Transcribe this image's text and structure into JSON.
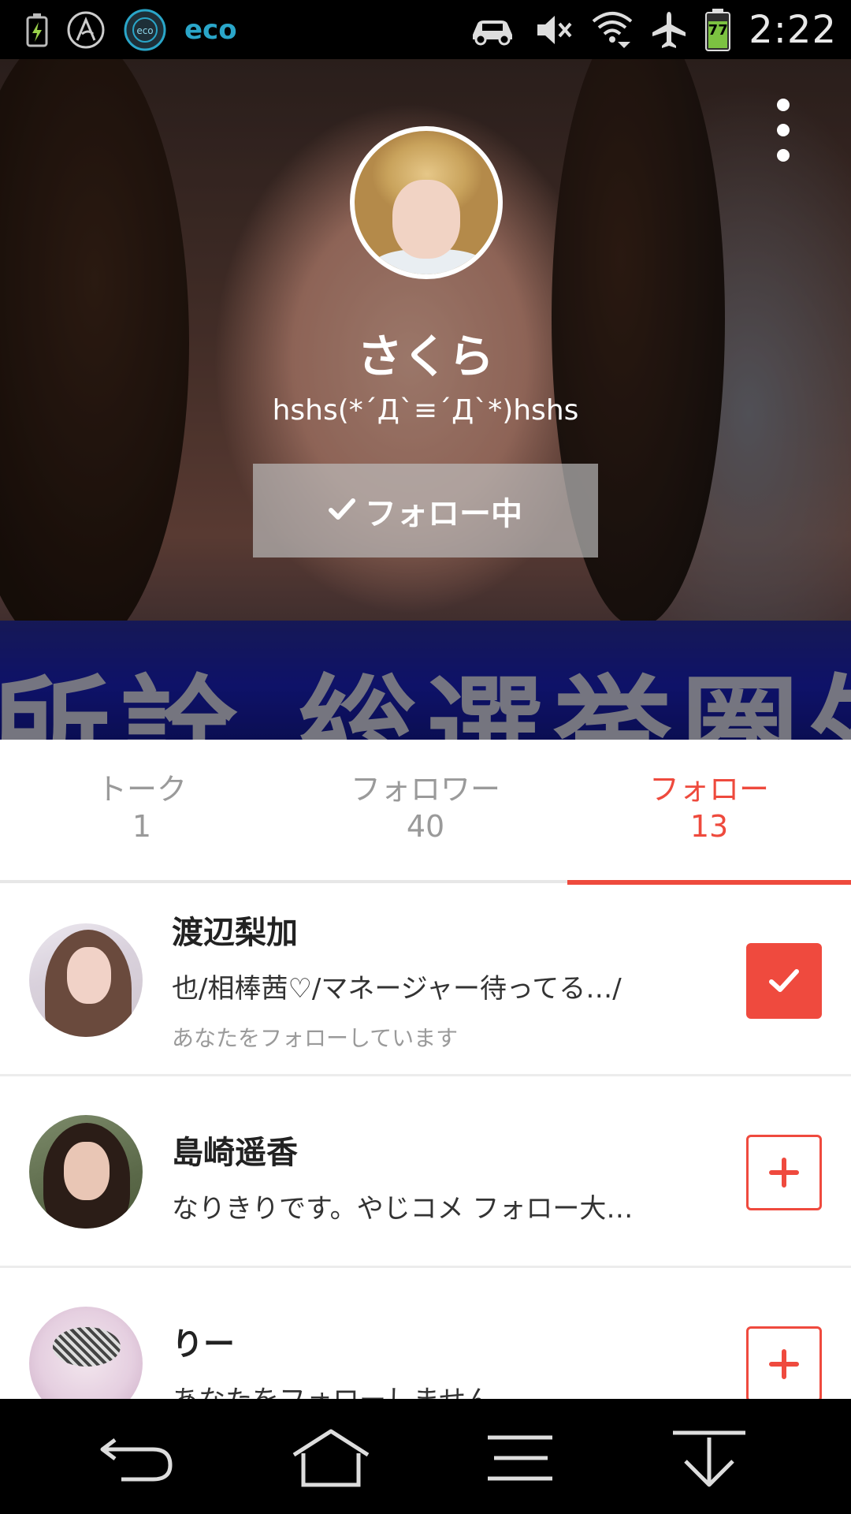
{
  "status_bar": {
    "time": "2:22",
    "battery_level": "77",
    "left_icons": [
      "battery-charging-icon",
      "app-logo-icon",
      "eco-circle-icon",
      "eco-text-icon"
    ],
    "right_icons": [
      "car-icon",
      "mute-icon",
      "wifi-icon",
      "airplane-icon",
      "battery-icon"
    ],
    "eco_label": "eco"
  },
  "profile": {
    "name": "さくら",
    "bio": "hshs(*´Д`≡´Д`*)hshs",
    "follow_button_label": "フォロー中",
    "banner_text": "所詮 総選挙圏外"
  },
  "tabs": [
    {
      "label": "トーク",
      "count": "1",
      "active": false
    },
    {
      "label": "フォロワー",
      "count": "40",
      "active": true
    },
    {
      "label": "フォロー",
      "count": "13",
      "active": true
    }
  ],
  "list": [
    {
      "name": "渡辺梨加",
      "bio": "也/相棒茜♡/マネージャー待ってる…/",
      "status": "あなたをフォローしています",
      "following": true
    },
    {
      "name": "島崎遥香",
      "bio": "なりきりです。やじコメ フォロー大…",
      "status": "",
      "following": false
    },
    {
      "name": "りー",
      "bio": "あなたをフォローしません",
      "status": "",
      "following": false
    }
  ],
  "colors": {
    "accent": "#ef4a3e",
    "tab_inactive": "#9a9a9a",
    "divider": "#ececec"
  },
  "nav_bar": {
    "icons": [
      "back-icon",
      "home-icon",
      "menu-icon",
      "download-icon"
    ]
  }
}
